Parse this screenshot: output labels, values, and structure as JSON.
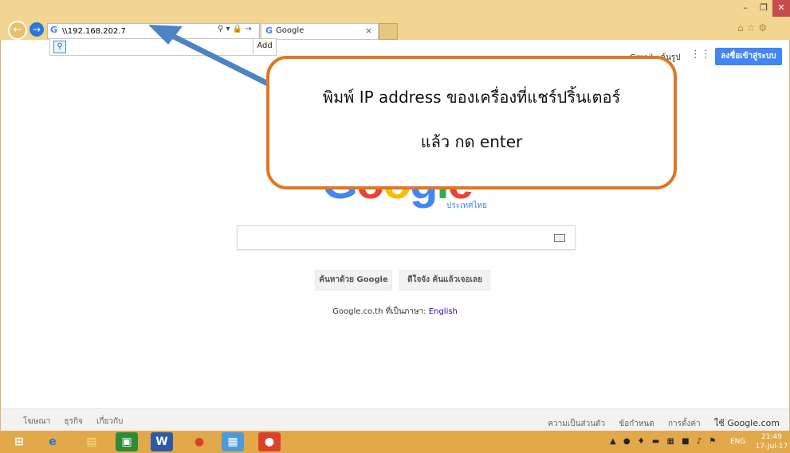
{
  "browser": {
    "address_value": "\\\\192.168.202.7",
    "address_icon": "google-g-icon",
    "tab_title": "Google",
    "suggestion_add_label": "Add",
    "window_buttons": [
      "–",
      "❐",
      "✕"
    ]
  },
  "google": {
    "top_links": [
      "Gmail",
      "ค้นรูป"
    ],
    "signin_label": "ลงชื่อเข้าสู่ระบบ",
    "logo_sub": "ประเทศไทย",
    "search_button": "ค้นหาด้วย Google",
    "lucky_button": "ดีใจจัง ค้นแล้วเจอเลย",
    "lang_prefix": "Google.co.th ที่เป็นภาษา:",
    "lang_link": "English",
    "footer_left": [
      "โฆษณา",
      "ธุรกิจ",
      "เกี่ยวกับ"
    ],
    "footer_right": [
      "ความเป็นส่วนตัว",
      "ข้อกำหนด",
      "การตั้งค่า",
      "ใช้ Google.com"
    ]
  },
  "callout": {
    "line1": "พิมพ์ IP address ของเครื่องที่แชร์ปริ้นเตอร์",
    "line2": "แล้ว กด enter"
  },
  "taskbar": {
    "lang": "ENG",
    "time": "21:49",
    "date": "17-Jul-17",
    "items": [
      "windows-start-icon",
      "internet-explorer-icon",
      "file-explorer-icon",
      "store-icon",
      "word-icon",
      "chrome-icon",
      "remote-desktop-icon",
      "paint-icon"
    ]
  },
  "colors": {
    "accent_orange": "#e07722",
    "arrow_blue": "#4d84c4",
    "google_blue": "#4285f4",
    "taskbar": "#e2a94a"
  }
}
